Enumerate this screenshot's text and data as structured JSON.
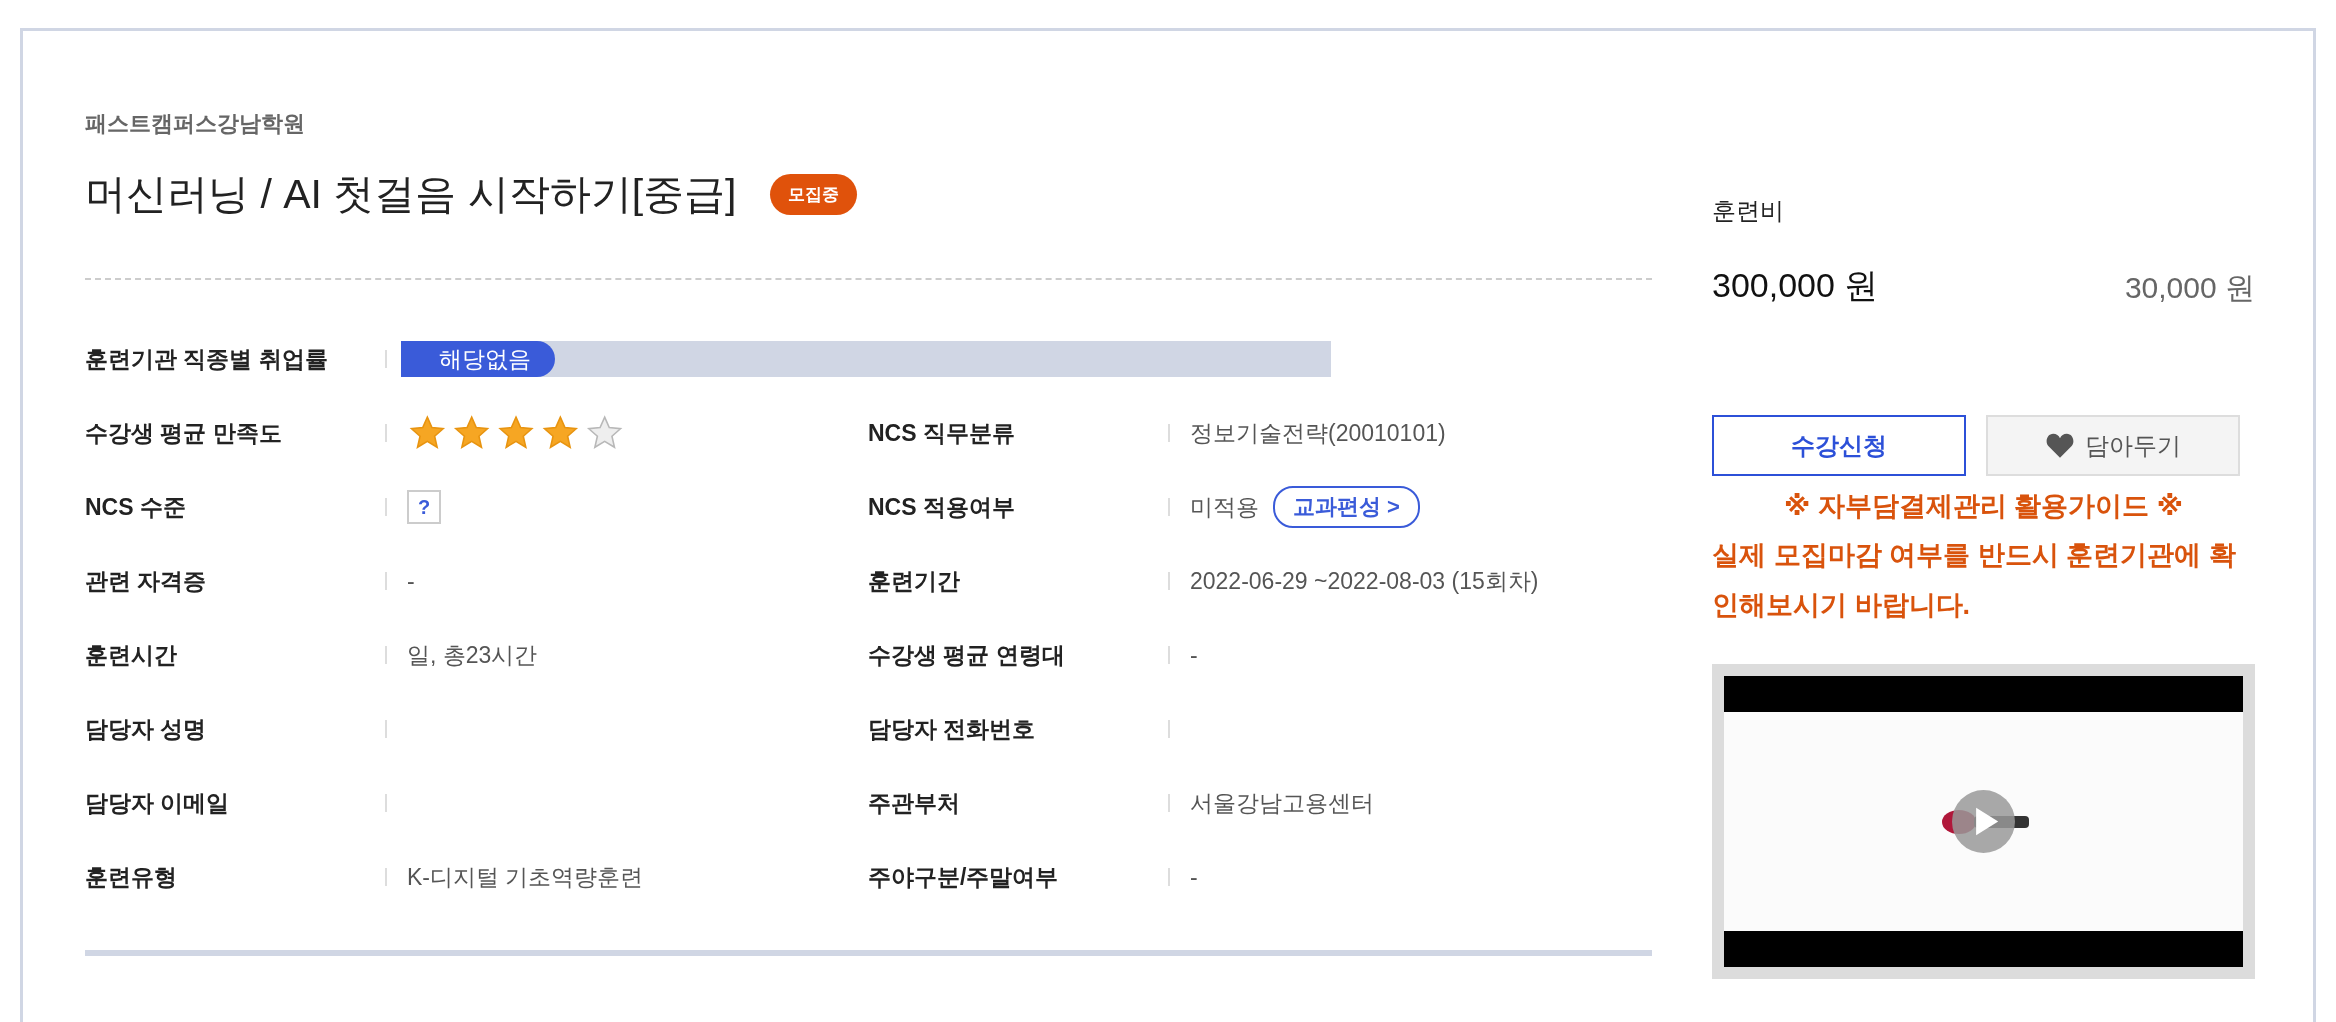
{
  "provider": "패스트캠퍼스강남학원",
  "title": "머신러닝 / AI 첫걸음 시작하기[중급]",
  "status_badge": "모집중",
  "employment": {
    "label": "훈련기관 직종별 취업률",
    "value": "해당없음"
  },
  "rows": [
    [
      {
        "label": "수강생 평균 만족도",
        "kind": "stars",
        "stars": 4
      },
      {
        "label": "NCS 직무분류",
        "kind": "text",
        "value": "정보기술전략(20010101)"
      }
    ],
    [
      {
        "label": "NCS 수준",
        "kind": "help",
        "value": "?"
      },
      {
        "label": "NCS 적용여부",
        "kind": "text-link",
        "value": "미적용",
        "link": "교과편성 >"
      }
    ],
    [
      {
        "label": "관련 자격증",
        "kind": "text",
        "value": "-"
      },
      {
        "label": "훈련기간",
        "kind": "text",
        "value": "2022-06-29 ~2022-08-03 (15회차)"
      }
    ],
    [
      {
        "label": "훈련시간",
        "kind": "text",
        "value": "일, 총23시간"
      },
      {
        "label": "수강생 평균 연령대",
        "kind": "text",
        "value": "-"
      }
    ],
    [
      {
        "label": "담당자 성명",
        "kind": "text"
      },
      {
        "label": "담당자 전화번호",
        "kind": "text"
      }
    ],
    [
      {
        "label": "담당자 이메일",
        "kind": "text"
      },
      {
        "label": "주관부처",
        "kind": "text",
        "value": "서울강남고용센터"
      }
    ],
    [
      {
        "label": "훈련유형",
        "kind": "text",
        "value": "K-디지털 기초역량훈련"
      },
      {
        "label": "주야구분/주말여부",
        "kind": "text",
        "value": "-"
      }
    ]
  ],
  "fee": {
    "label": "훈련비",
    "price": "300,000 원",
    "self_pay": "30,000 원"
  },
  "buttons": [
    {
      "label": "수강신청",
      "kind": "primary"
    },
    {
      "label": "담아두기",
      "kind": "wishlist"
    }
  ],
  "guide": "※ 자부담결제관리 활용가이드 ※",
  "warning": "실제 모집마감 여부를 반드시 훈련기관에 확인해보시기 바랍니다."
}
